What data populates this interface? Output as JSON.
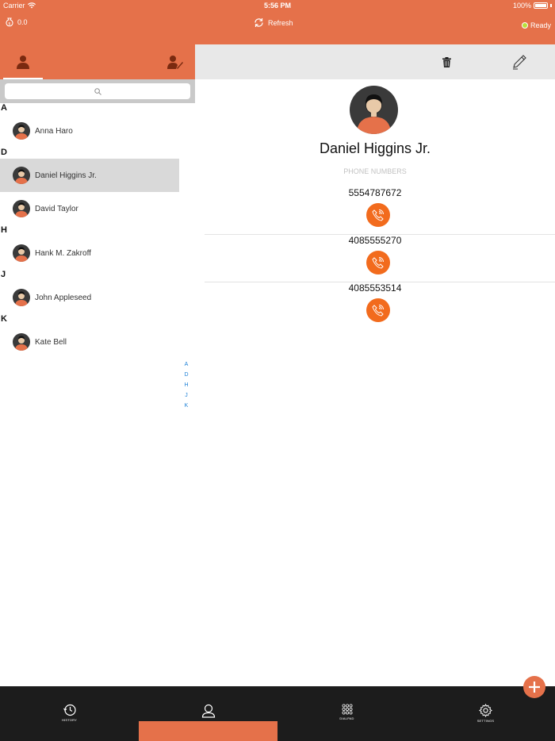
{
  "status_bar": {
    "carrier": "Carrier",
    "time": "5:56 PM",
    "battery": "100%"
  },
  "header": {
    "balance": "0.0",
    "refresh_label": "Refresh",
    "status": "Ready"
  },
  "contacts": {
    "sections": [
      {
        "letter": "A",
        "items": [
          {
            "name": "Anna Haro"
          }
        ]
      },
      {
        "letter": "D",
        "items": [
          {
            "name": "Daniel Higgins Jr.",
            "selected": true
          },
          {
            "name": "David Taylor"
          }
        ]
      },
      {
        "letter": "H",
        "items": [
          {
            "name": "Hank M. Zakroff"
          }
        ]
      },
      {
        "letter": "J",
        "items": [
          {
            "name": "John Appleseed"
          }
        ]
      },
      {
        "letter": "K",
        "items": [
          {
            "name": "Kate Bell"
          }
        ]
      }
    ],
    "index": [
      "A",
      "D",
      "H",
      "J",
      "K"
    ]
  },
  "detail": {
    "name": "Daniel Higgins Jr.",
    "phones_title": "PHONE NUMBERS",
    "phones": [
      "5554787672",
      "4085555270",
      "4085553514"
    ]
  },
  "tabbar": {
    "items": [
      {
        "label": "HISTORY",
        "icon": "history-icon"
      },
      {
        "label": "",
        "icon": "contacts-icon",
        "active": true
      },
      {
        "label": "DIALPAD",
        "icon": "dialpad-icon"
      },
      {
        "label": "SETTINGS",
        "icon": "settings-icon"
      }
    ]
  },
  "colors": {
    "accent": "#e5714a",
    "call": "#f26b1d",
    "index": "#1a7fd6",
    "tabbar": "#1c1c1c"
  }
}
